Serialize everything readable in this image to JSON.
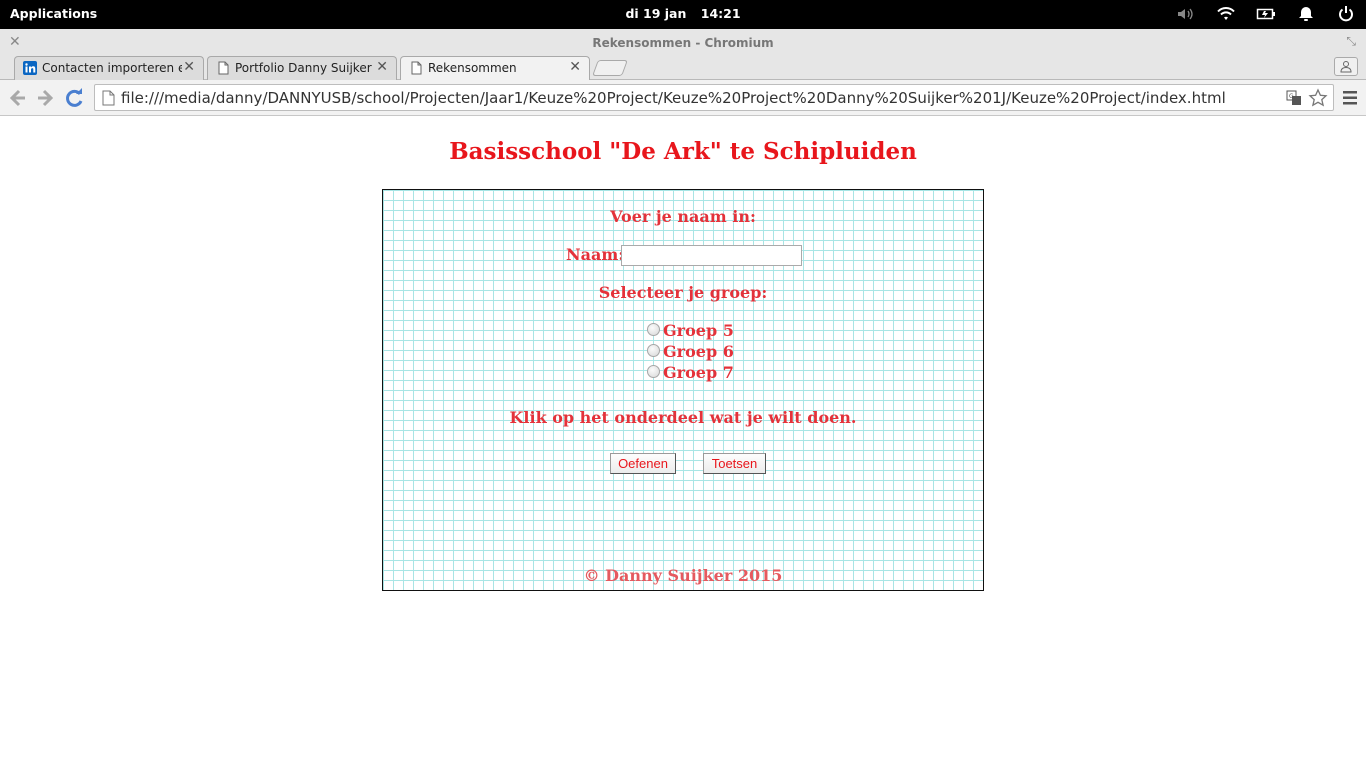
{
  "system_bar": {
    "apps_label": "Applications",
    "date": "di 19 jan",
    "time": "14:21"
  },
  "window": {
    "title": "Rekensommen - Chromium"
  },
  "tabs": [
    {
      "label": "Contacten importeren en u",
      "favicon": "linkedin-icon"
    },
    {
      "label": "Portfolio Danny Suijker",
      "favicon": "page-icon"
    },
    {
      "label": "Rekensommen",
      "favicon": "page-icon",
      "active": true
    }
  ],
  "address_bar": {
    "url": "file:///media/danny/DANNYUSB/school/Projecten/Jaar1/Keuze%20Project/Keuze%20Project%20Danny%20Suijker%201J/Keuze%20Project/index.html"
  },
  "page": {
    "heading": "Basisschool \"De Ark\" te Schipluiden",
    "name_prompt": "Voer je naam in:",
    "name_label": "Naam:",
    "name_value": "",
    "group_prompt": "Selecteer je groep:",
    "groups": [
      "Groep 5",
      "Groep 6",
      "Groep 7"
    ],
    "action_prompt": "Klik op het onderdeel wat je wilt doen.",
    "buttons": {
      "practice": "Oefenen",
      "test": "Toetsen"
    },
    "copyright": "© Danny Suijker 2015"
  },
  "colors": {
    "accent_red": "#e8161c",
    "grid_line": "#a9e5e5"
  }
}
